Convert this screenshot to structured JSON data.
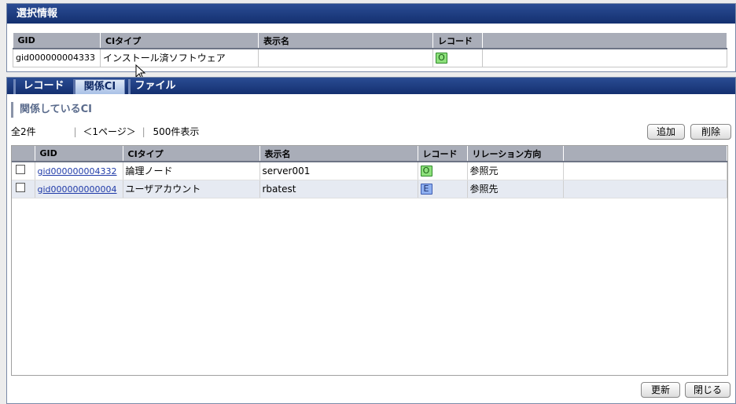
{
  "selection_panel": {
    "title": "選択情報",
    "columns": [
      "GID",
      "CIタイプ",
      "表示名",
      "レコード"
    ],
    "row": {
      "gid": "gid000000004333",
      "ci_type": "インストール済ソフトウェア",
      "display_name": "",
      "record": "O"
    }
  },
  "tabs": [
    {
      "label": "レコード",
      "active": false
    },
    {
      "label": "関係CI",
      "active": true
    },
    {
      "label": "ファイル",
      "active": false
    }
  ],
  "related": {
    "section_title": "関係しているCI",
    "pager": {
      "total": "全2件",
      "pages": "＜1ページ＞",
      "per_page": "500件表示"
    },
    "add_button": "追加",
    "delete_button": "削除",
    "columns": [
      "GID",
      "CIタイプ",
      "表示名",
      "レコード",
      "リレーション方向"
    ],
    "rows": [
      {
        "gid": "gid000000004332",
        "ci_type": "論理ノード",
        "display_name": "server001",
        "record": "O",
        "direction": "参照元"
      },
      {
        "gid": "gid000000000004",
        "ci_type": "ユーザアカウント",
        "display_name": "rbatest",
        "record": "E",
        "direction": "参照先"
      }
    ]
  },
  "footer": {
    "refresh_button": "更新",
    "close_button": "閉じる"
  }
}
